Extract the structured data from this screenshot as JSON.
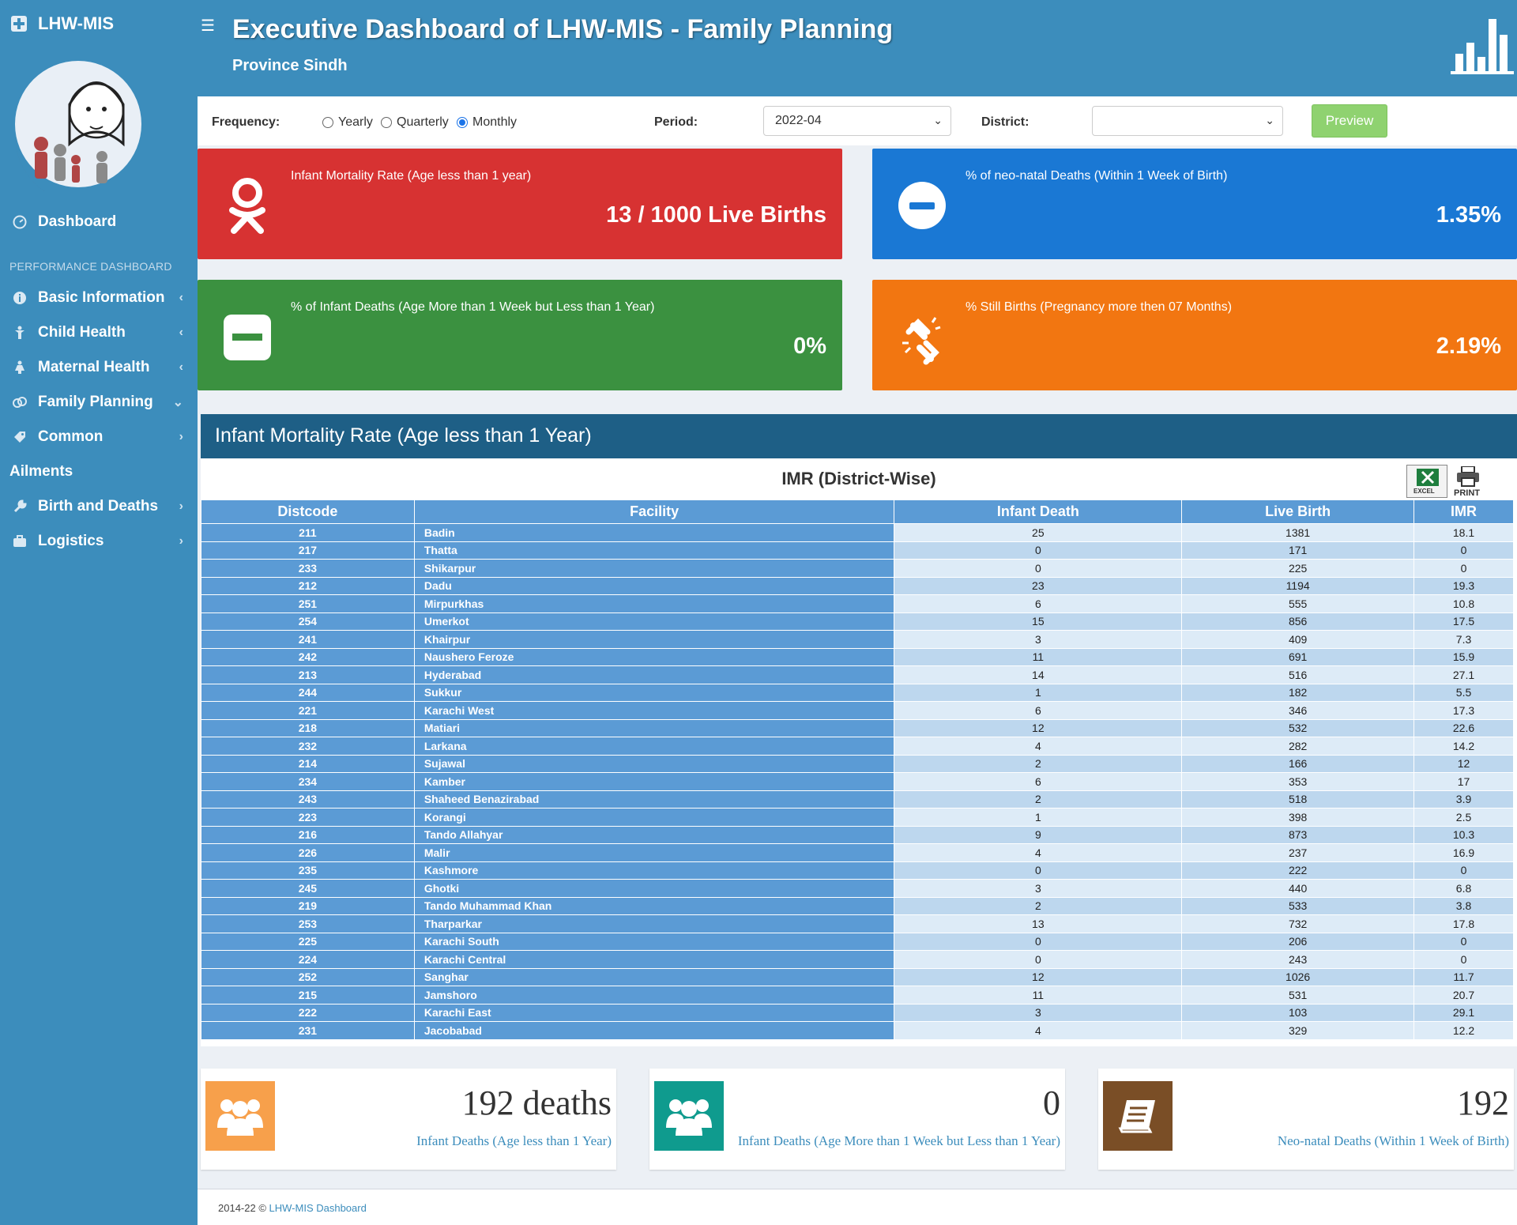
{
  "app": {
    "brand": "LHW-MIS"
  },
  "sidebar": {
    "dashboard": "Dashboard",
    "header": "PERFORMANCE DASHBOARD",
    "items": [
      {
        "label": "Basic Information",
        "icon": "info-icon",
        "chev": "‹"
      },
      {
        "label": "Child Health",
        "icon": "child-icon",
        "chev": "‹"
      },
      {
        "label": "Maternal Health",
        "icon": "female-icon",
        "chev": "‹"
      },
      {
        "label": "Family Planning",
        "icon": "gender-icon",
        "chev": "⌄"
      },
      {
        "label": "Common",
        "icon": "tag-icon",
        "chev": "›"
      }
    ],
    "plain": "Ailments",
    "items2": [
      {
        "label": "Birth and Deaths",
        "icon": "wrench-icon",
        "chev": "›"
      },
      {
        "label": "Logistics",
        "icon": "briefcase-icon",
        "chev": "›"
      }
    ]
  },
  "header": {
    "title": "Executive Dashboard of LHW-MIS - Family Planning",
    "subtitle": "Province Sindh"
  },
  "filters": {
    "frequency_label": "Frequency:",
    "options": [
      "Yearly",
      "Quarterly",
      "Monthly"
    ],
    "selected": "Monthly",
    "period_label": "Period:",
    "period_value": "2022-04",
    "district_label": "District:",
    "district_value": "",
    "preview": "Preview"
  },
  "infoboxes": [
    {
      "label": "Infant Mortality Rate (Age less than 1 year)",
      "value": "13 / 1000 Live Births",
      "color": "#d73232"
    },
    {
      "label": "% of neo-natal Deaths (Within 1 Week of Birth)",
      "value": "1.35%",
      "color": "#1a78d4"
    },
    {
      "label": "% of Infant Deaths (Age More than 1 Week but Less than 1 Year)",
      "value": "0%",
      "color": "#3b9140"
    },
    {
      "label": "% Still Births (Pregnancy more then 07 Months)",
      "value": "2.19%",
      "color": "#f27611"
    }
  ],
  "panel": {
    "title": "Infant Mortality Rate (Age less than 1 Year)",
    "caption": "IMR (District-Wise)",
    "excel_label": "EXCEL",
    "print_label": "PRINT",
    "columns": [
      "Distcode",
      "Facility",
      "Infant Death",
      "Live Birth",
      "IMR"
    ],
    "rows": [
      [
        "211",
        "Badin",
        "25",
        "1381",
        "18.1"
      ],
      [
        "217",
        "Thatta",
        "0",
        "171",
        "0"
      ],
      [
        "233",
        "Shikarpur",
        "0",
        "225",
        "0"
      ],
      [
        "212",
        "Dadu",
        "23",
        "1194",
        "19.3"
      ],
      [
        "251",
        "Mirpurkhas",
        "6",
        "555",
        "10.8"
      ],
      [
        "254",
        "Umerkot",
        "15",
        "856",
        "17.5"
      ],
      [
        "241",
        "Khairpur",
        "3",
        "409",
        "7.3"
      ],
      [
        "242",
        "Naushero Feroze",
        "11",
        "691",
        "15.9"
      ],
      [
        "213",
        "Hyderabad",
        "14",
        "516",
        "27.1"
      ],
      [
        "244",
        "Sukkur",
        "1",
        "182",
        "5.5"
      ],
      [
        "221",
        "Karachi West",
        "6",
        "346",
        "17.3"
      ],
      [
        "218",
        "Matiari",
        "12",
        "532",
        "22.6"
      ],
      [
        "232",
        "Larkana",
        "4",
        "282",
        "14.2"
      ],
      [
        "214",
        "Sujawal",
        "2",
        "166",
        "12"
      ],
      [
        "234",
        "Kamber",
        "6",
        "353",
        "17"
      ],
      [
        "243",
        "Shaheed Benazirabad",
        "2",
        "518",
        "3.9"
      ],
      [
        "223",
        "Korangi",
        "1",
        "398",
        "2.5"
      ],
      [
        "216",
        "Tando Allahyar",
        "9",
        "873",
        "10.3"
      ],
      [
        "226",
        "Malir",
        "4",
        "237",
        "16.9"
      ],
      [
        "235",
        "Kashmore",
        "0",
        "222",
        "0"
      ],
      [
        "245",
        "Ghotki",
        "3",
        "440",
        "6.8"
      ],
      [
        "219",
        "Tando Muhammad Khan",
        "2",
        "533",
        "3.8"
      ],
      [
        "253",
        "Tharparkar",
        "13",
        "732",
        "17.8"
      ],
      [
        "225",
        "Karachi South",
        "0",
        "206",
        "0"
      ],
      [
        "224",
        "Karachi Central",
        "0",
        "243",
        "0"
      ],
      [
        "252",
        "Sanghar",
        "12",
        "1026",
        "11.7"
      ],
      [
        "215",
        "Jamshoro",
        "11",
        "531",
        "20.7"
      ],
      [
        "222",
        "Karachi East",
        "3",
        "103",
        "29.1"
      ],
      [
        "231",
        "Jacobabad",
        "4",
        "329",
        "12.2"
      ]
    ]
  },
  "stats": [
    {
      "value": "192 deaths",
      "label": "Infant Deaths (Age less than 1 Year)",
      "color": "#f7a04b",
      "icon": "users-icon"
    },
    {
      "value": "0",
      "label": "Infant Deaths (Age More than 1 Week but Less than 1 Year)",
      "color": "#0f9b8e",
      "icon": "users-icon"
    },
    {
      "value": "192",
      "label": "Neo-natal Deaths (Within 1 Week of Birth)",
      "color": "#7a4e26",
      "icon": "book-icon"
    }
  ],
  "footer": {
    "text": "2014-22 © ",
    "link": "LHW-MIS Dashboard"
  }
}
